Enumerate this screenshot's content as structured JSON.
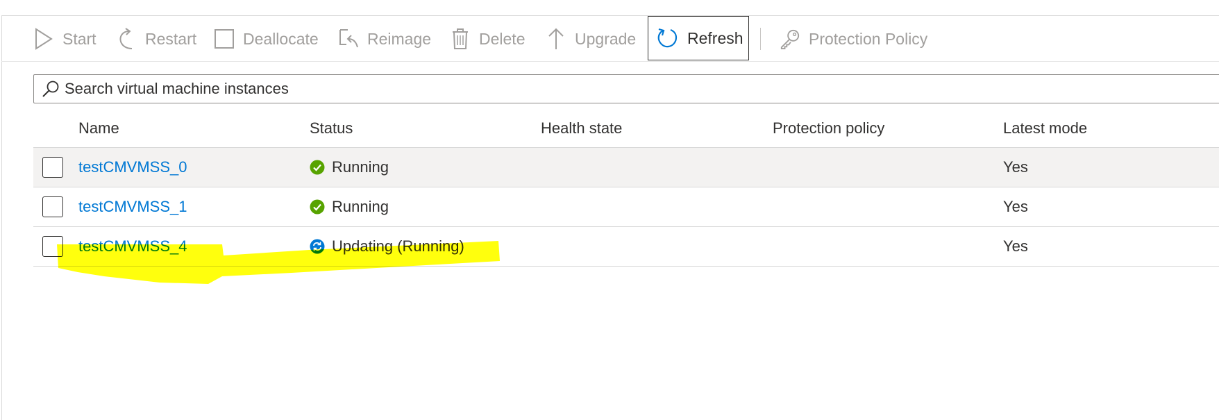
{
  "toolbar": {
    "start_label": "Start",
    "restart_label": "Restart",
    "deallocate_label": "Deallocate",
    "reimage_label": "Reimage",
    "delete_label": "Delete",
    "upgrade_label": "Upgrade",
    "refresh_label": "Refresh",
    "protection_policy_label": "Protection Policy"
  },
  "search": {
    "placeholder": "Search virtual machine instances"
  },
  "table": {
    "columns": {
      "name": "Name",
      "status": "Status",
      "health_state": "Health state",
      "protection_policy": "Protection policy",
      "latest_model": "Latest mode"
    },
    "rows": [
      {
        "name": "testCMVMSS_0",
        "status": "Running",
        "status_icon": "success-check-icon",
        "health_state": "",
        "protection_policy": "",
        "latest_model": "Yes"
      },
      {
        "name": "testCMVMSS_1",
        "status": "Running",
        "status_icon": "success-check-icon",
        "health_state": "",
        "protection_policy": "",
        "latest_model": "Yes"
      },
      {
        "name": "testCMVMSS_4",
        "status": "Updating (Running)",
        "status_icon": "updating-sync-icon",
        "health_state": "",
        "protection_policy": "",
        "latest_model": "Yes"
      }
    ]
  },
  "colors": {
    "link": "#0078d4",
    "success": "#57a300",
    "updating": "#0078d4",
    "highlight": "#ffff00",
    "disabled_text": "#a19f9d"
  }
}
